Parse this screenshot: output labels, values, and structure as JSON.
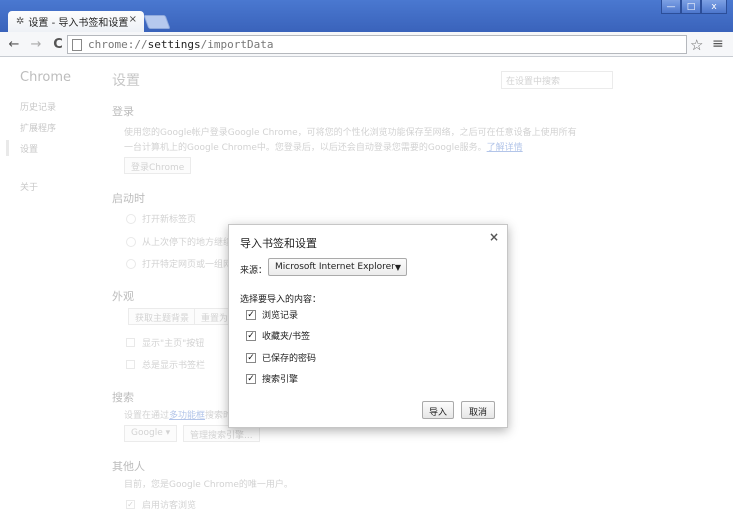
{
  "window": {
    "tab_title": "设置 - 导入书签和设置",
    "tab_close": "×",
    "min": "—",
    "max": "□",
    "close": "x"
  },
  "toolbar": {
    "back": "←",
    "forward": "→",
    "reload": "C",
    "url_scheme": "chrome://",
    "url_host": "settings",
    "url_path": "/importData"
  },
  "sidebar": {
    "title": "Chrome",
    "items": [
      "历史记录",
      "扩展程序",
      "设置",
      "关于"
    ]
  },
  "settings": {
    "title": "设置",
    "search_placeholder": "在设置中搜索",
    "signin_heading": "登录",
    "signin_text_1": "使用您的Google帐户登录Google Chrome，可将您的个性化浏览功能保存至网络，之后可在任意设备上使用所有",
    "signin_text_2": "一台计算机上的Google Chrome中。您登录后，以后还会自动登录您需要的Google服务。",
    "signin_learn_more": "了解详情",
    "signin_button": "登录Chrome",
    "startup_heading": "启动时",
    "startup_options": [
      "打开新标签页",
      "从上次停下的地方继续",
      "打开特定网页或一组网页"
    ],
    "appearance_heading": "外观",
    "get_themes_button": "获取主题背景",
    "reset_theme_button": "重置为默认主题",
    "show_home_button": "显示\"主页\"按钮",
    "show_bookmarks_bar": "总是显示书签栏",
    "search_heading": "搜索",
    "search_text": "设置在通过",
    "search_text_link": "多功能框",
    "search_text_rest": "搜索时所用的搜索引擎。",
    "search_engine_select": "Google",
    "manage_engines_button": "管理搜索引擎...",
    "people_heading": "其他人",
    "people_text": "目前，您是Google Chrome的唯一用户。",
    "guest_browsing": "启用访客浏览"
  },
  "dialog": {
    "title": "导入书签和设置",
    "close": "×",
    "source_label": "来源：",
    "source_value": "Microsoft Internet Explorer",
    "items_label": "选择要导入的内容：",
    "items": [
      {
        "label": "浏览记录",
        "checked": true
      },
      {
        "label": "收藏夹/书签",
        "checked": true
      },
      {
        "label": "已保存的密码",
        "checked": true
      },
      {
        "label": "搜索引擎",
        "checked": true
      }
    ],
    "import_button": "导入",
    "cancel_button": "取消"
  }
}
